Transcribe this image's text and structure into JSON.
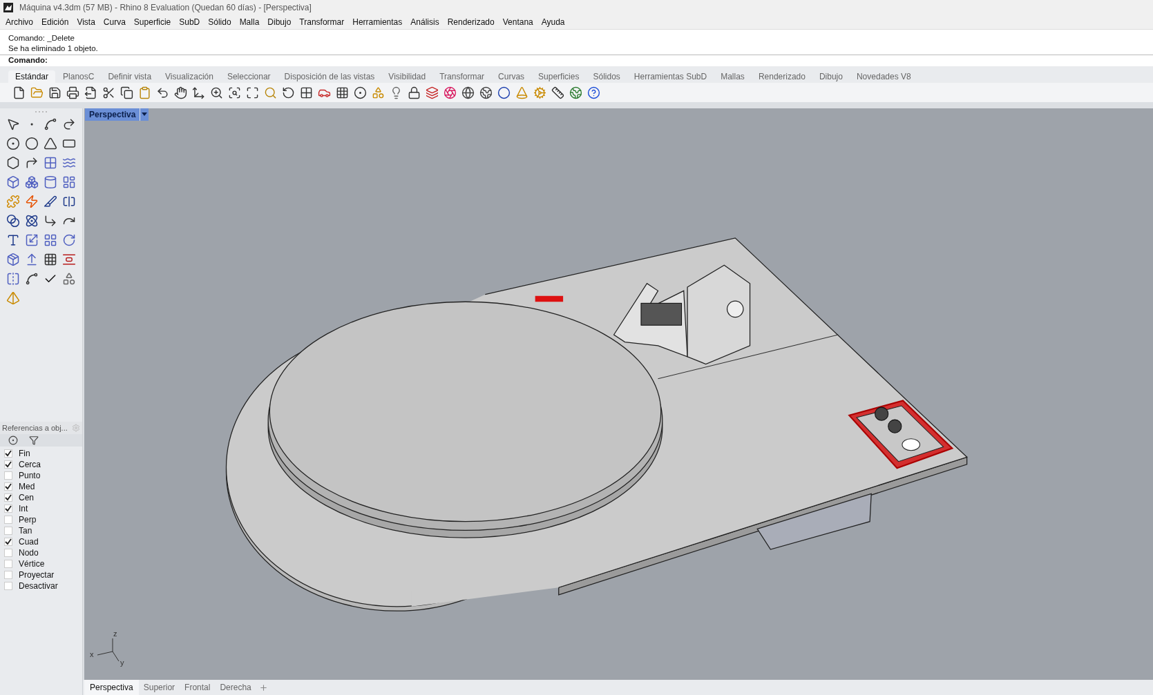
{
  "window": {
    "title": "Máquina v4.3dm (57 MB) - Rhino 8 Evaluation (Quedan 60 días) - [Perspectiva]"
  },
  "menu": [
    "Archivo",
    "Edición",
    "Vista",
    "Curva",
    "Superficie",
    "SubD",
    "Sólido",
    "Malla",
    "Dibujo",
    "Transformar",
    "Herramientas",
    "Análisis",
    "Renderizado",
    "Ventana",
    "Ayuda"
  ],
  "command_history": [
    "Comando: _Delete",
    "Se ha eliminado 1 objeto."
  ],
  "command_prompt": {
    "label": "Comando:"
  },
  "toolbar_tabs": [
    {
      "label": "Estándar",
      "selected": true
    },
    {
      "label": "PlanosC",
      "selected": false
    },
    {
      "label": "Definir vista",
      "selected": false
    },
    {
      "label": "Visualización",
      "selected": false
    },
    {
      "label": "Seleccionar",
      "selected": false
    },
    {
      "label": "Disposición de las vistas",
      "selected": false
    },
    {
      "label": "Visibilidad",
      "selected": false
    },
    {
      "label": "Transformar",
      "selected": false
    },
    {
      "label": "Curvas",
      "selected": false
    },
    {
      "label": "Superficies",
      "selected": false
    },
    {
      "label": "Sólidos",
      "selected": false
    },
    {
      "label": "Herramientas SubD",
      "selected": false
    },
    {
      "label": "Mallas",
      "selected": false
    },
    {
      "label": "Renderizado",
      "selected": false
    },
    {
      "label": "Dibujo",
      "selected": false
    },
    {
      "label": "Novedades V8",
      "selected": false
    }
  ],
  "snap_panel": {
    "title": "Referencias a obj...",
    "snaps": [
      {
        "label": "Fin",
        "checked": true
      },
      {
        "label": "Cerca",
        "checked": true
      },
      {
        "label": "Punto",
        "checked": false
      },
      {
        "label": "Med",
        "checked": true
      },
      {
        "label": "Cen",
        "checked": true
      },
      {
        "label": "Int",
        "checked": true
      },
      {
        "label": "Perp",
        "checked": false
      },
      {
        "label": "Tan",
        "checked": false
      },
      {
        "label": "Cuad",
        "checked": true
      },
      {
        "label": "Nodo",
        "checked": false
      },
      {
        "label": "Vértice",
        "checked": false
      },
      {
        "label": "Proyectar",
        "checked": false
      },
      {
        "label": "Desactivar",
        "checked": false
      }
    ]
  },
  "viewport": {
    "title": "Perspectiva",
    "axis_labels": [
      "z",
      "x",
      "y"
    ]
  },
  "view_tabs": [
    {
      "label": "Perspectiva",
      "selected": true
    },
    {
      "label": "Superior",
      "selected": false
    },
    {
      "label": "Frontal",
      "selected": false
    },
    {
      "label": "Derecha",
      "selected": false
    }
  ]
}
